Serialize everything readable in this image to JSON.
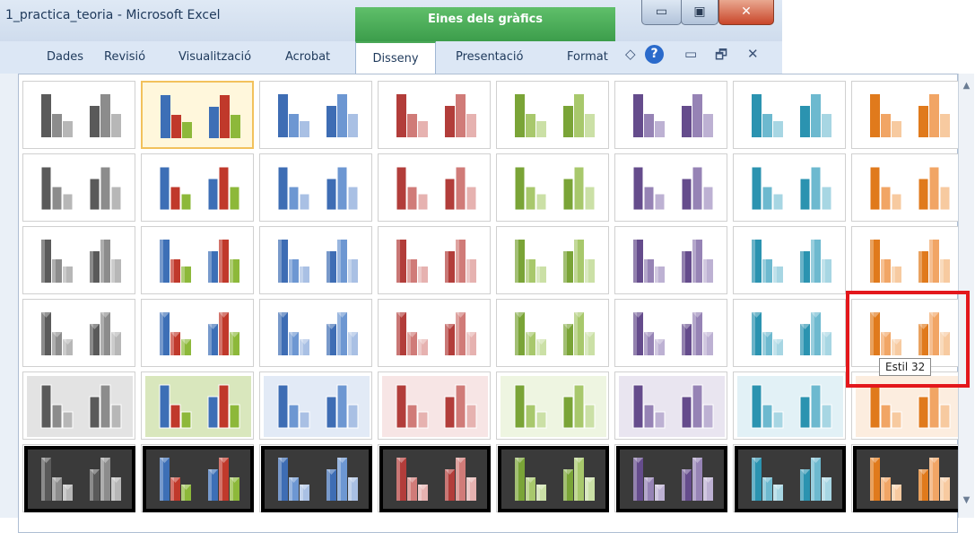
{
  "window": {
    "title": "1_practica_teoria  -  Microsoft Excel",
    "contextual_group": "Eines dels gràfics",
    "controls": {
      "minimize": "▭",
      "maximize": "▣",
      "close": "✕"
    }
  },
  "tabs": [
    {
      "label": "Dades"
    },
    {
      "label": "Revisió"
    },
    {
      "label": "Visualització"
    },
    {
      "label": "Acrobat"
    },
    {
      "label": "Disseny"
    },
    {
      "label": "Presentació"
    },
    {
      "label": "Format"
    }
  ],
  "ribbon_icons": [
    "ribbon-collapse-icon",
    "help-icon",
    "minimize-icon",
    "restore-icon",
    "close-icon"
  ],
  "ribbon_glyphs": {
    "collapse": "◇",
    "help": "?",
    "minimize": "▭",
    "restore": "🗗",
    "close": "✕"
  },
  "gallery": {
    "name": "chart styles",
    "rows": 6,
    "columns": 8,
    "selected_style": 2,
    "highlighted_style": 32,
    "palettes": [
      {
        "name": "gray",
        "colors": [
          "#5a5a5a",
          "#8c8c8c",
          "#b7b7b7"
        ]
      },
      {
        "name": "multicolor",
        "colors": [
          "#3d6fb6",
          "#c0392b",
          "#8db83a"
        ]
      },
      {
        "name": "blue",
        "colors": [
          "#3e6db4",
          "#6d97d2",
          "#a9c0e4"
        ]
      },
      {
        "name": "red",
        "colors": [
          "#b23d3a",
          "#d07b78",
          "#e6b2b0"
        ]
      },
      {
        "name": "green",
        "colors": [
          "#7aa437",
          "#a8c86c",
          "#cbe0a6"
        ]
      },
      {
        "name": "purple",
        "colors": [
          "#654c8c",
          "#9683b5",
          "#bdb1d3"
        ]
      },
      {
        "name": "teal",
        "colors": [
          "#2b93b0",
          "#6db9cf",
          "#a7d6e3"
        ]
      },
      {
        "name": "orange",
        "colors": [
          "#e07a1c",
          "#f1a565",
          "#f7caa0"
        ]
      }
    ],
    "row_styles": [
      "flat",
      "flat-outline",
      "shaded",
      "3d",
      "tinted-background",
      "dark-background"
    ]
  },
  "tooltip": {
    "text": "Estil 32"
  },
  "scroll": {
    "up": "▲",
    "down": "▼"
  }
}
